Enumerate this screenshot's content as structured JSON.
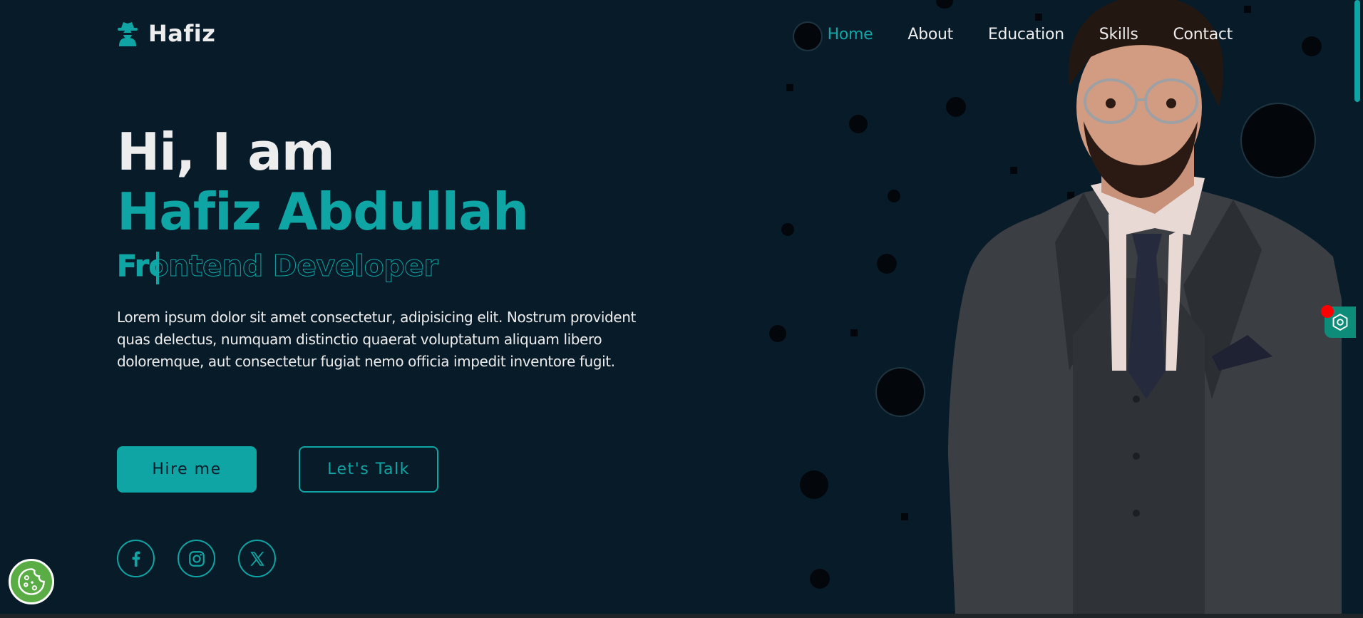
{
  "logo": {
    "text": "Hafiz",
    "icon": "spy-icon"
  },
  "nav": {
    "items": [
      {
        "label": "Home",
        "active": true
      },
      {
        "label": "About",
        "active": false
      },
      {
        "label": "Education",
        "active": false
      },
      {
        "label": "Skills",
        "active": false
      },
      {
        "label": "Contact",
        "active": false
      }
    ]
  },
  "hero": {
    "greeting": "Hi, I am",
    "name": "Hafiz Abdullah",
    "role": "Frontend Developer",
    "role_typed": "Fro",
    "description": "Lorem ipsum dolor sit amet consectetur, adipisicing elit. Nostrum provident quas delectus, numquam distinctio quaerat voluptatum aliquam libero doloremque, aut consectetur fugiat nemo officia impedit inventore fugit."
  },
  "buttons": {
    "hire_label": "Hire me",
    "talk_label": "Let's Talk"
  },
  "socials": [
    {
      "icon": "facebook-icon"
    },
    {
      "icon": "instagram-icon"
    },
    {
      "icon": "x-twitter-icon"
    }
  ],
  "widgets": {
    "cookie_icon": "cookie-icon",
    "side_icon": "hexagon-settings-icon"
  },
  "colors": {
    "background": "#081b29",
    "accent": "#0ea5a4",
    "text": "#ededed",
    "cookie": "#5aad45",
    "notification": "#ff0000"
  }
}
